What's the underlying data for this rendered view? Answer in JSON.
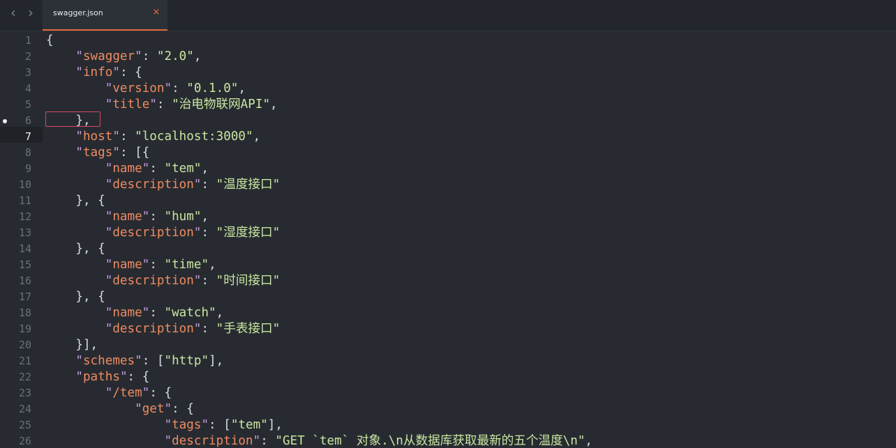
{
  "tabbar": {
    "back_icon": "chevron-left-icon",
    "forward_icon": "chevron-right-icon",
    "active_tab": {
      "title": "swagger.json",
      "close_icon": "close-icon",
      "accent_color": "#e0693e"
    }
  },
  "editor": {
    "current_line": 7,
    "modified_line": 6,
    "lines": [
      {
        "n": "1",
        "text": "{"
      },
      {
        "n": "2",
        "text": "    \"swagger\": \"2.0\","
      },
      {
        "n": "3",
        "text": "    \"info\": {"
      },
      {
        "n": "4",
        "text": "        \"version\": \"0.1.0\","
      },
      {
        "n": "5",
        "text": "        \"title\": \"治电物联网API\","
      },
      {
        "n": "6",
        "text": "    },"
      },
      {
        "n": "7",
        "text": "    \"host\": \"localhost:3000\","
      },
      {
        "n": "8",
        "text": "    \"tags\": [{"
      },
      {
        "n": "9",
        "text": "        \"name\": \"tem\","
      },
      {
        "n": "10",
        "text": "        \"description\": \"温度接口\""
      },
      {
        "n": "11",
        "text": "    }, {"
      },
      {
        "n": "12",
        "text": "        \"name\": \"hum\","
      },
      {
        "n": "13",
        "text": "        \"description\": \"湿度接口\""
      },
      {
        "n": "14",
        "text": "    }, {"
      },
      {
        "n": "15",
        "text": "        \"name\": \"time\","
      },
      {
        "n": "16",
        "text": "        \"description\": \"时间接口\""
      },
      {
        "n": "17",
        "text": "    }, {"
      },
      {
        "n": "18",
        "text": "        \"name\": \"watch\","
      },
      {
        "n": "19",
        "text": "        \"description\": \"手表接口\""
      },
      {
        "n": "20",
        "text": "    }],"
      },
      {
        "n": "21",
        "text": "    \"schemes\": [\"http\"],"
      },
      {
        "n": "22",
        "text": "    \"paths\": {"
      },
      {
        "n": "23",
        "text": "        \"/tem\": {"
      },
      {
        "n": "24",
        "text": "            \"get\": {"
      },
      {
        "n": "25",
        "text": "                \"tags\": [\"tem\"],"
      },
      {
        "n": "26",
        "text": "                \"description\": \"GET `tem` 对象.\\n从数据库获取最新的五个温度\\n\","
      }
    ]
  },
  "colors": {
    "background": "#272b31",
    "tabbar": "#23272d",
    "line_number": "#68707a",
    "key": "#f08b61",
    "key_quote": "#c59bdd",
    "string": "#c9e5a0",
    "punctuation": "#d8dde2",
    "bracket_match": "#d24a63"
  }
}
